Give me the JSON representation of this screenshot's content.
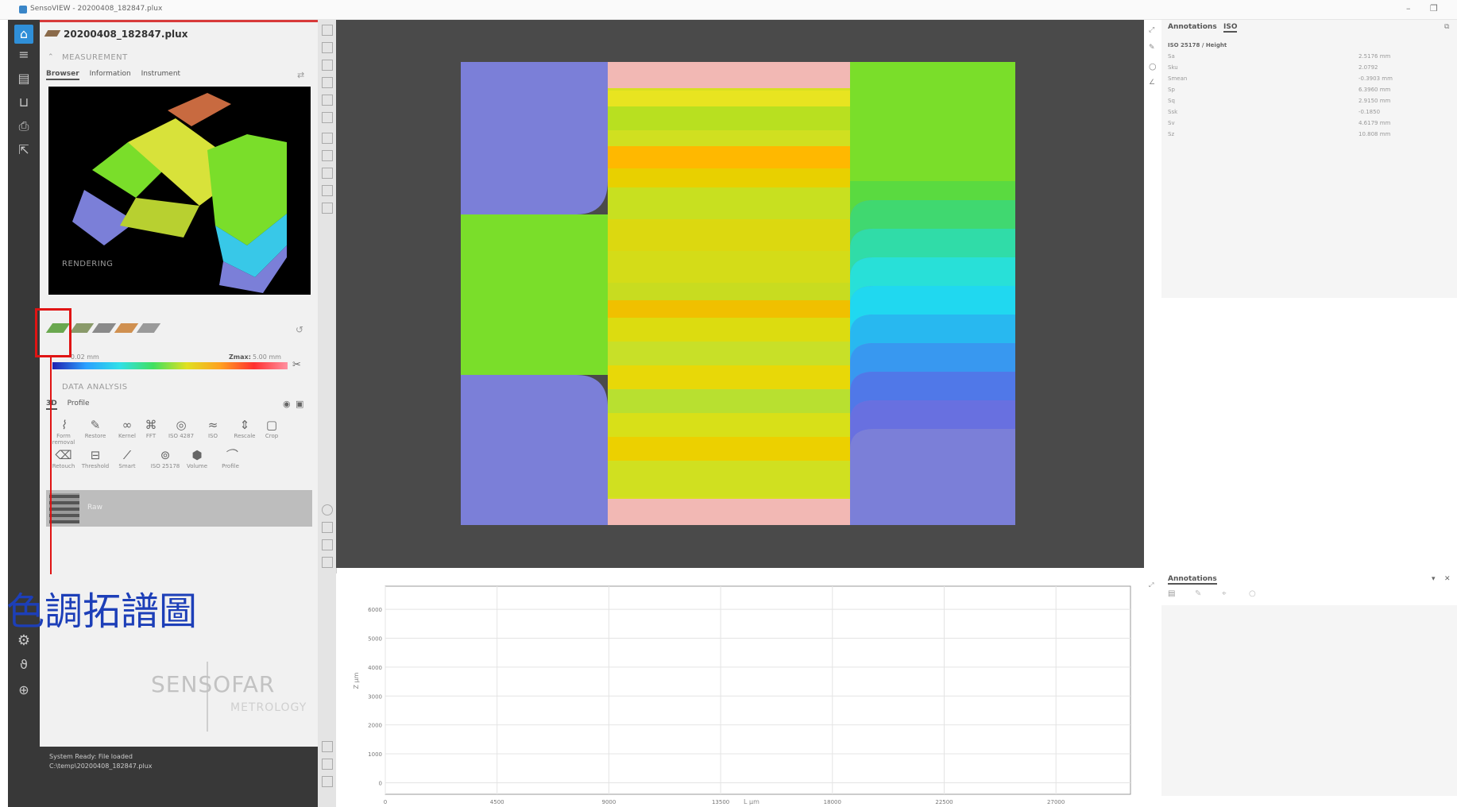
{
  "window": {
    "title": "SensoVIEW - 20200408_182847.plux",
    "min_symbol": "–",
    "max_symbol": "❐"
  },
  "toolbar_left": {
    "icons": [
      "home-icon",
      "menu-icon",
      "folder-icon",
      "save-icon",
      "print-icon",
      "export-icon"
    ],
    "bottom_icons": [
      "settings-icon",
      "stethoscope-icon",
      "globe-icon"
    ]
  },
  "measurement": {
    "file_name": "20200408_182847.plux",
    "section_label": "MEASUREMENT",
    "tabs": [
      "Browser",
      "Information",
      "Instrument"
    ],
    "active_tab": "Browser"
  },
  "rendering": {
    "section_label": "RENDERING",
    "zmin": "-0.02 mm",
    "zmax_label": "Zmax:",
    "zmax_value": "5.00 mm",
    "icon_colors": [
      "#6aa84f",
      "#8a9a6a",
      "#8a8a8a",
      "#d09050",
      "#9a9a9a"
    ]
  },
  "data_analysis": {
    "section_label": "DATA ANALYSIS",
    "tabs": [
      "3D",
      "Profile"
    ],
    "row1": [
      "Form removal",
      "Restore",
      "Kernel",
      "FFT",
      "ISO 4287",
      "ISO",
      "Rescale",
      "Crop"
    ],
    "row2": [
      "Retouch",
      "Threshold",
      "Smart",
      "ISO 25178",
      "Volume",
      "Profile"
    ]
  },
  "layer": {
    "name": "Raw"
  },
  "annotation": {
    "label": "色調拓譜圖"
  },
  "logo": {
    "main": "SENSOFAR",
    "sub": "METROLOGY"
  },
  "status": {
    "line1": "System Ready: File loaded",
    "line2": "C:\\temp\\20200408_182847.plux"
  },
  "right_panel": {
    "tabs": [
      "Annotations",
      "ISO"
    ],
    "active_tab": "ISO",
    "iso_header": "ISO 25178 / Height",
    "params": [
      {
        "name": "Sa",
        "value": "2.5176 mm"
      },
      {
        "name": "Sku",
        "value": "2.0792"
      },
      {
        "name": "Smean",
        "value": "-0.3903 mm"
      },
      {
        "name": "Sp",
        "value": "6.3960 mm"
      },
      {
        "name": "Sq",
        "value": "2.9150 mm"
      },
      {
        "name": "Ssk",
        "value": "-0.1850"
      },
      {
        "name": "Sv",
        "value": "4.6179 mm"
      },
      {
        "name": "Sz",
        "value": "10.808 mm"
      }
    ]
  },
  "annotations_bottom": {
    "title": "Annotations",
    "pin": "▾",
    "close": "✕"
  },
  "chart_data": {
    "type": "line",
    "title": "",
    "xlabel": "L µm",
    "ylabel": "Z µm",
    "x_ticks": [
      "0",
      "4500",
      "9000",
      "13500",
      "18000",
      "22500",
      "27000"
    ],
    "y_ticks": [
      "0",
      "1000",
      "2000",
      "3000",
      "4000",
      "5000",
      "6000"
    ],
    "xlim": [
      0,
      30000
    ],
    "ylim": [
      -400,
      6800
    ],
    "grid": true,
    "series": []
  },
  "colors": {
    "accent": "#2f8fd8",
    "topo_purple": "#7b7fd8",
    "topo_green": "#7ade2a",
    "topo_pink": "#f2b8b4",
    "annotation_blue": "#1d3fb8",
    "highlight_red": "#e01414"
  }
}
